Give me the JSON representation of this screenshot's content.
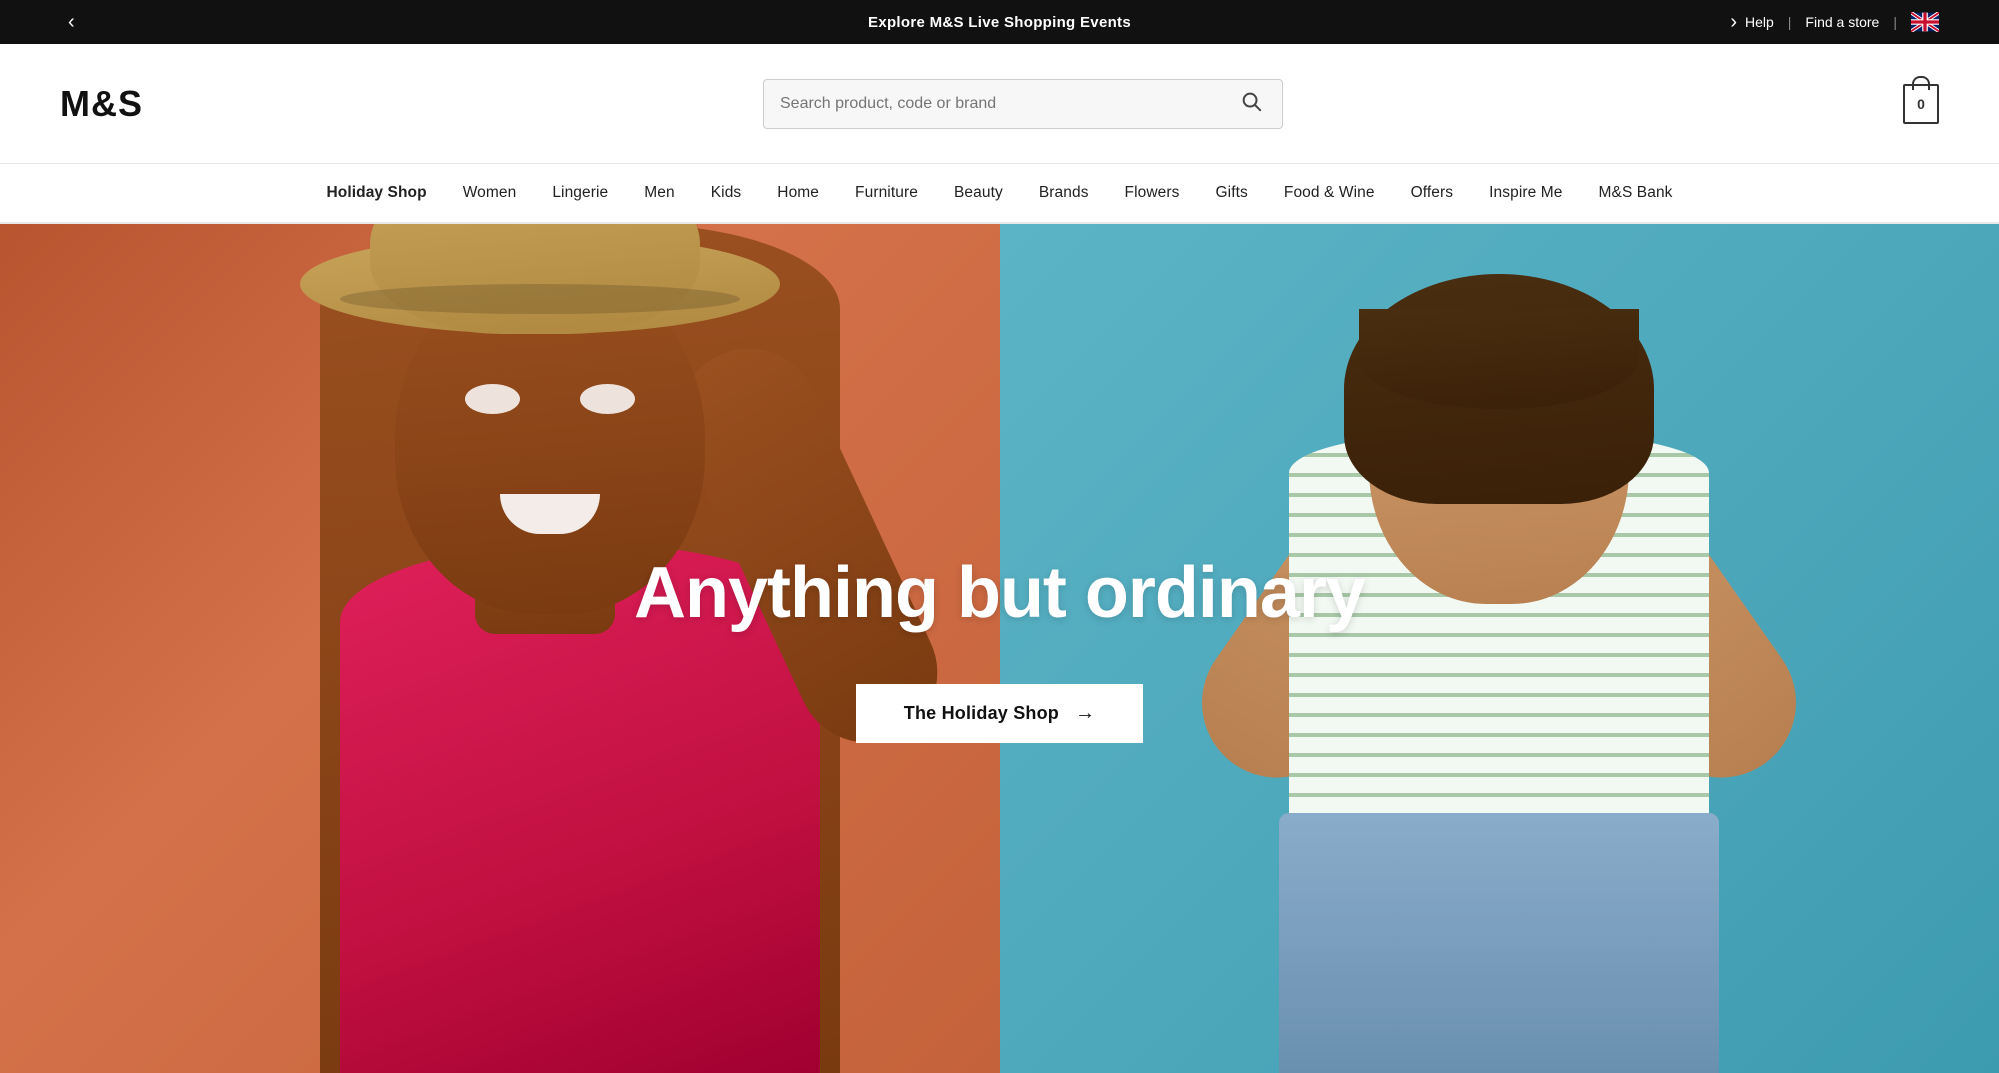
{
  "announcement": {
    "text": "Explore M&S Live Shopping Events",
    "prev_label": "‹",
    "next_label": "›"
  },
  "top_right": {
    "help": "Help",
    "divider1": "|",
    "find_store": "Find a store",
    "divider2": "|"
  },
  "header": {
    "logo": "M&S",
    "search_placeholder": "Search product, code or brand",
    "cart_count": "0"
  },
  "nav": {
    "items": [
      {
        "label": "Holiday Shop",
        "active": true
      },
      {
        "label": "Women",
        "active": false
      },
      {
        "label": "Lingerie",
        "active": false
      },
      {
        "label": "Men",
        "active": false
      },
      {
        "label": "Kids",
        "active": false
      },
      {
        "label": "Home",
        "active": false
      },
      {
        "label": "Furniture",
        "active": false
      },
      {
        "label": "Beauty",
        "active": false
      },
      {
        "label": "Brands",
        "active": false
      },
      {
        "label": "Flowers",
        "active": false
      },
      {
        "label": "Gifts",
        "active": false
      },
      {
        "label": "Food & Wine",
        "active": false
      },
      {
        "label": "Offers",
        "active": false
      },
      {
        "label": "Inspire Me",
        "active": false
      },
      {
        "label": "M&S Bank",
        "active": false
      }
    ]
  },
  "hero": {
    "headline": "Anything but ordinary",
    "cta_label": "The Holiday Shop",
    "cta_arrow": "→"
  }
}
